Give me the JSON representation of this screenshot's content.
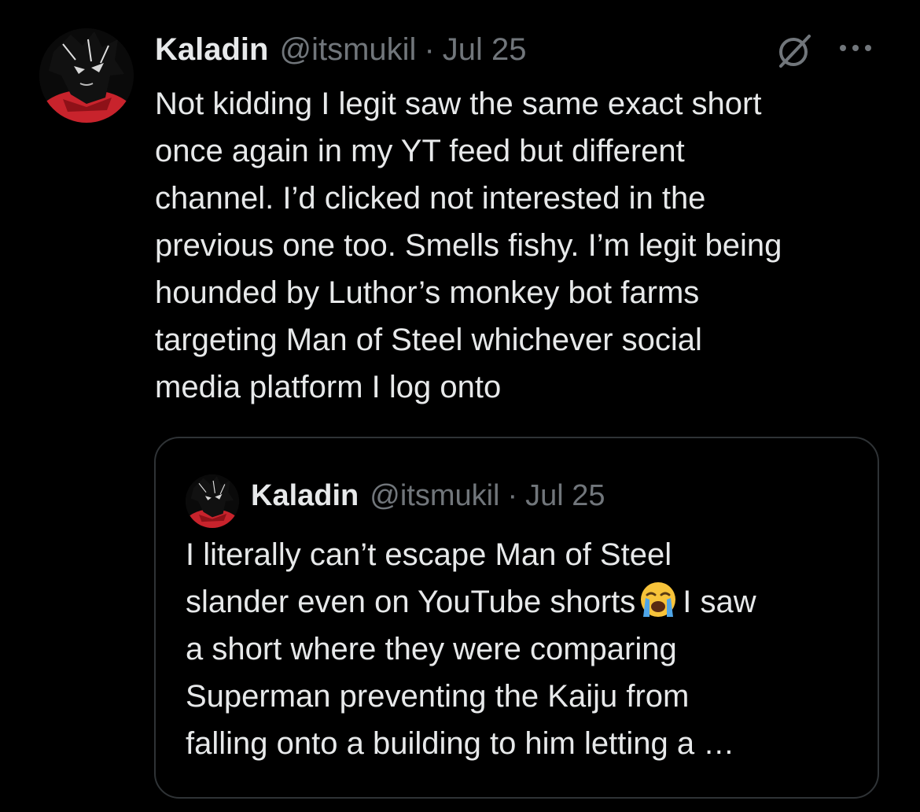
{
  "tweet": {
    "author_name": "Kaladin",
    "handle": "@itsmukil",
    "separator": "·",
    "date": "Jul 25",
    "avatar_icon": "anime-character-avatar-icon",
    "grok_icon": "grok-icon",
    "more_icon": "more-options-icon",
    "text": "Not kidding I legit saw the same exact short\nonce again in my YT feed but different\nchannel. I’d clicked not interested in the\nprevious one too. Smells fishy. I’m legit being\nhounded by Luthor’s monkey bot farms\ntargeting Man of Steel whichever social\nmedia platform I log onto"
  },
  "quote": {
    "author_name": "Kaladin",
    "handle": "@itsmukil",
    "separator": "·",
    "date": "Jul 25",
    "lines": {
      "l1": "I literally can’t escape Man of Steel",
      "l2a": "slander even on YouTube shorts",
      "l2b": "I saw",
      "l3": "a short where they were comparing",
      "l4": "Superman preventing the Kaiju from",
      "l5": "falling onto a building to him letting a …"
    },
    "emoji_icon": "loudly-crying-face-emoji"
  },
  "colors": {
    "background": "#000000",
    "primary_text": "#e7e9ea",
    "secondary_text": "#71767b",
    "border": "#2f3336",
    "avatar_accent": "#c8232c"
  }
}
